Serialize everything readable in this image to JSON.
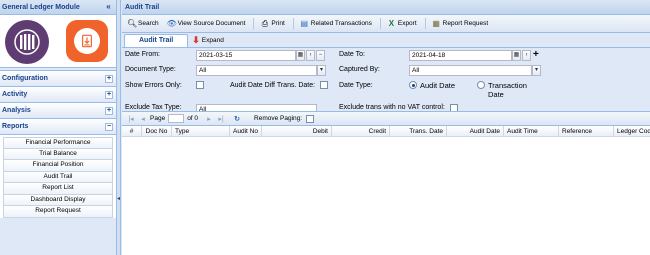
{
  "sidebar": {
    "title": "General Ledger Module",
    "collapse_glyph": "«",
    "sections": [
      {
        "label": "Configuration",
        "toggle": "+"
      },
      {
        "label": "Activity",
        "toggle": "+"
      },
      {
        "label": "Analysis",
        "toggle": "+"
      },
      {
        "label": "Reports",
        "toggle": "−"
      }
    ],
    "reports": [
      "Financial Performance",
      "Trial Balance",
      "Financial Position",
      "Audit Trail",
      "Report List",
      "Dashboard Display",
      "Report Request"
    ]
  },
  "panel": {
    "title": "Audit Trail",
    "toolbar": {
      "search": "Search",
      "view_source": "View Source Document",
      "print": "Print",
      "related": "Related Transactions",
      "export": "Export",
      "report_request": "Report Request"
    },
    "tabs": {
      "active": "Audit Trail",
      "expand": "Expand"
    }
  },
  "form": {
    "date_from_label": "Date From:",
    "date_from": "2021-03-15",
    "date_to_label": "Date To:",
    "date_to": "2021-04-18",
    "doc_type_label": "Document Type:",
    "doc_type": "All",
    "captured_by_label": "Captured By:",
    "captured_by": "All",
    "show_errors_label": "Show Errors Only:",
    "audit_diff_label": "Audit Date Diff Trans. Date:",
    "date_type_label": "Date Type:",
    "date_type_audit": "Audit Date",
    "date_type_trans": "Transaction Date",
    "exclude_tax_label": "Exclude Tax Type:",
    "exclude_tax": "All",
    "exclude_vat_label": "Exclude trans with no VAT control:"
  },
  "pager": {
    "page_label": "Page",
    "of_label": "of 0",
    "remove_paging_label": "Remove Paging:"
  },
  "grid": {
    "columns": [
      "#",
      "Doc No",
      "Type",
      "Audit No",
      "Debit",
      "Credit",
      "Trans. Date",
      "Audit Date",
      "Audit Time",
      "Reference",
      "Ledger Code"
    ]
  },
  "colors": {
    "header_blue": "#15428b",
    "panel_bg": "#dfe8f6",
    "tile_purple": "#5f3d72",
    "tile_orange": "#f0632b"
  }
}
